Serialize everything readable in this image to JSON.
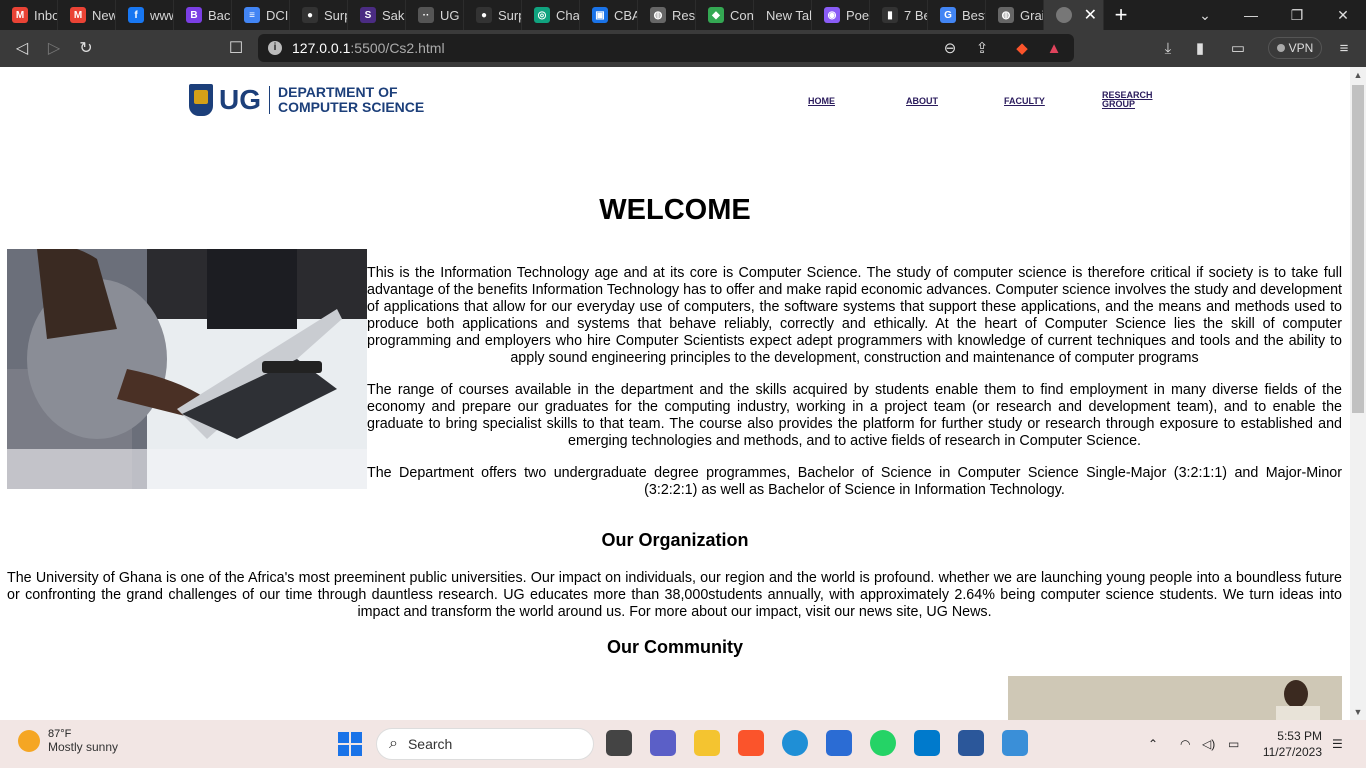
{
  "browser": {
    "tabs": [
      {
        "label": "Inbo",
        "fav_color": "#ea4335",
        "fav_glyph": "M"
      },
      {
        "label": "New",
        "fav_color": "#ea4335",
        "fav_glyph": "M"
      },
      {
        "label": "www",
        "fav_color": "#1877f2",
        "fav_glyph": "f"
      },
      {
        "label": "Back",
        "fav_color": "#7b3fe4",
        "fav_glyph": "B"
      },
      {
        "label": "DCI",
        "fav_color": "#4285f4",
        "fav_glyph": "≡"
      },
      {
        "label": "Surp",
        "fav_color": "#333333",
        "fav_glyph": "●"
      },
      {
        "label": "Saka",
        "fav_color": "#4b2c83",
        "fav_glyph": "S"
      },
      {
        "label": "UG",
        "fav_color": "#555555",
        "fav_glyph": "··"
      },
      {
        "label": "Surp",
        "fav_color": "#333333",
        "fav_glyph": "●"
      },
      {
        "label": "Chat",
        "fav_color": "#10a37f",
        "fav_glyph": "◎"
      },
      {
        "label": "CBA",
        "fav_color": "#1a73e8",
        "fav_glyph": "▣"
      },
      {
        "label": "Rese",
        "fav_color": "#666666",
        "fav_glyph": "◍"
      },
      {
        "label": "Con",
        "fav_color": "#34a853",
        "fav_glyph": "◆"
      },
      {
        "label": "New Tab",
        "fav_color": "",
        "fav_glyph": ""
      },
      {
        "label": "Poe",
        "fav_color": "#8a5cf6",
        "fav_glyph": "◉"
      },
      {
        "label": "7 Be",
        "fav_color": "#333333",
        "fav_glyph": "▮"
      },
      {
        "label": "Best",
        "fav_color": "#4285f4",
        "fav_glyph": "G"
      },
      {
        "label": "Grai",
        "fav_color": "#666666",
        "fav_glyph": "◍"
      }
    ],
    "url_host": "127.0.0.1",
    "url_path": ":5500/Cs2.html",
    "vpn_label": "VPN"
  },
  "page": {
    "logo_ug": "UG",
    "logo_dept_line1": "DEPARTMENT OF",
    "logo_dept_line2": "COMPUTER SCIENCE",
    "nav": {
      "home": "HOME",
      "about": "ABOUT",
      "faculty": "FACULTY",
      "research_line1": "RESEARCH",
      "research_line2": "GROUP"
    },
    "welcome": "WELCOME",
    "intro_p1": "This is the Information Technology age and at its core is Computer Science. The study of computer science is therefore critical if society is to take full advantage of the benefits Information Technology has to offer and make rapid economic advances. Computer science involves the study and development of applications that allow for our everyday use of computers, the software systems that support these applications, and the means and methods used to produce both applications and systems that behave reliably, correctly and ethically. At the heart of Computer Science lies the skill of computer programming and employers who hire Computer Scientists expect adept programmers with knowledge of current techniques and tools and the ability to apply sound engineering principles to the development, construction and maintenance of computer programs",
    "intro_p2": "The range of courses available in the department and the skills acquired by students enable them to find employment in many diverse fields of the economy and prepare our graduates for the computing industry, working in a project team (or research and development team), and to enable the graduate to bring specialist skills to that team. The course also provides the platform for further study or research through exposure to established and emerging technologies and methods, and to active fields of research in Computer Science.",
    "intro_p3": "The Department offers two undergraduate degree programmes, Bachelor of Science in Computer Science Single-Major (3:2:1:1) and Major-Minor (3:2:2:1) as well as Bachelor of Science in Information Technology.",
    "org_heading": "Our Organization",
    "org_text": "The University of Ghana is one of the Africa's most preeminent public universities. Our impact on individuals, our region and the world is profound. whether we are launching young people into a boundless future or confronting the grand challenges of our time through dauntless research. UG educates more than 38,000students annually, with approximately 2.64% being computer science students. We turn ideas into impact and transform the world around us. For more about our impact, visit our news site, UG News.",
    "community_heading": "Our Community"
  },
  "taskbar": {
    "temp": "87°F",
    "weather": "Mostly sunny",
    "search_placeholder": "Search",
    "time": "5:53 PM",
    "date": "11/27/2023"
  }
}
